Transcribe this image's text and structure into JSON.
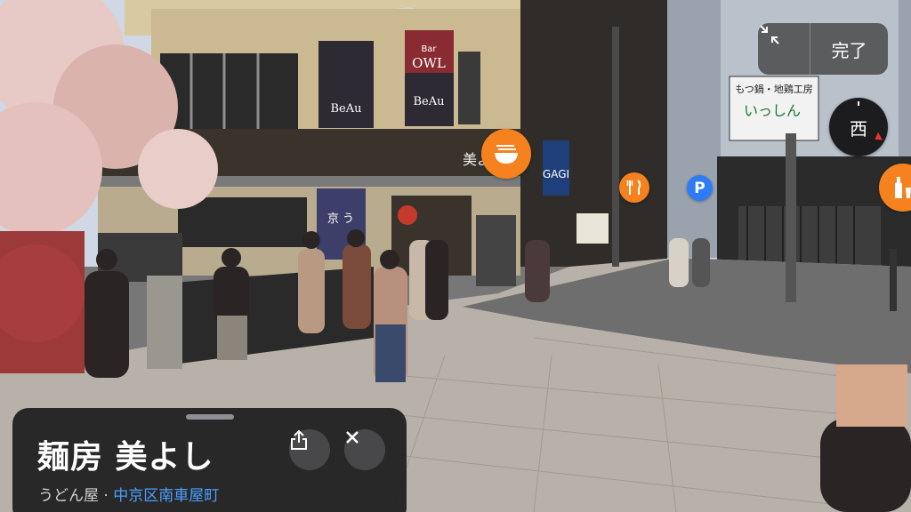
{
  "viewer": {
    "exit_icon": "collapse-arrows-icon",
    "done_label": "完了",
    "compass_heading": "西"
  },
  "poi_markers": [
    {
      "name": "ramen",
      "icon": "ramen-bowl-icon",
      "color": "#f5821f"
    },
    {
      "name": "restaurant",
      "icon": "fork-knife-icon",
      "color": "#f5821f"
    },
    {
      "name": "parking",
      "icon": "parking-icon",
      "label": "P",
      "color": "#2d7cf6"
    },
    {
      "name": "bar",
      "icon": "bottle-icon",
      "color": "#f5821f"
    }
  ],
  "signs": {
    "owl_small": "Bar",
    "owl": "OWL",
    "beau_left": "BeAu",
    "beau_right": "BeAu",
    "noren": "京 う",
    "shop_text": "美よし",
    "nokoro": "もつ鍋・地鶏工房",
    "nokoro_logo": "いっしん",
    "gaiki": "GAGI"
  },
  "place_card": {
    "title": "麺房 美よし",
    "category": "うどん屋",
    "separator": " · ",
    "location": "中京区南車屋町",
    "share_icon": "share-icon",
    "close_icon": "close-icon"
  }
}
